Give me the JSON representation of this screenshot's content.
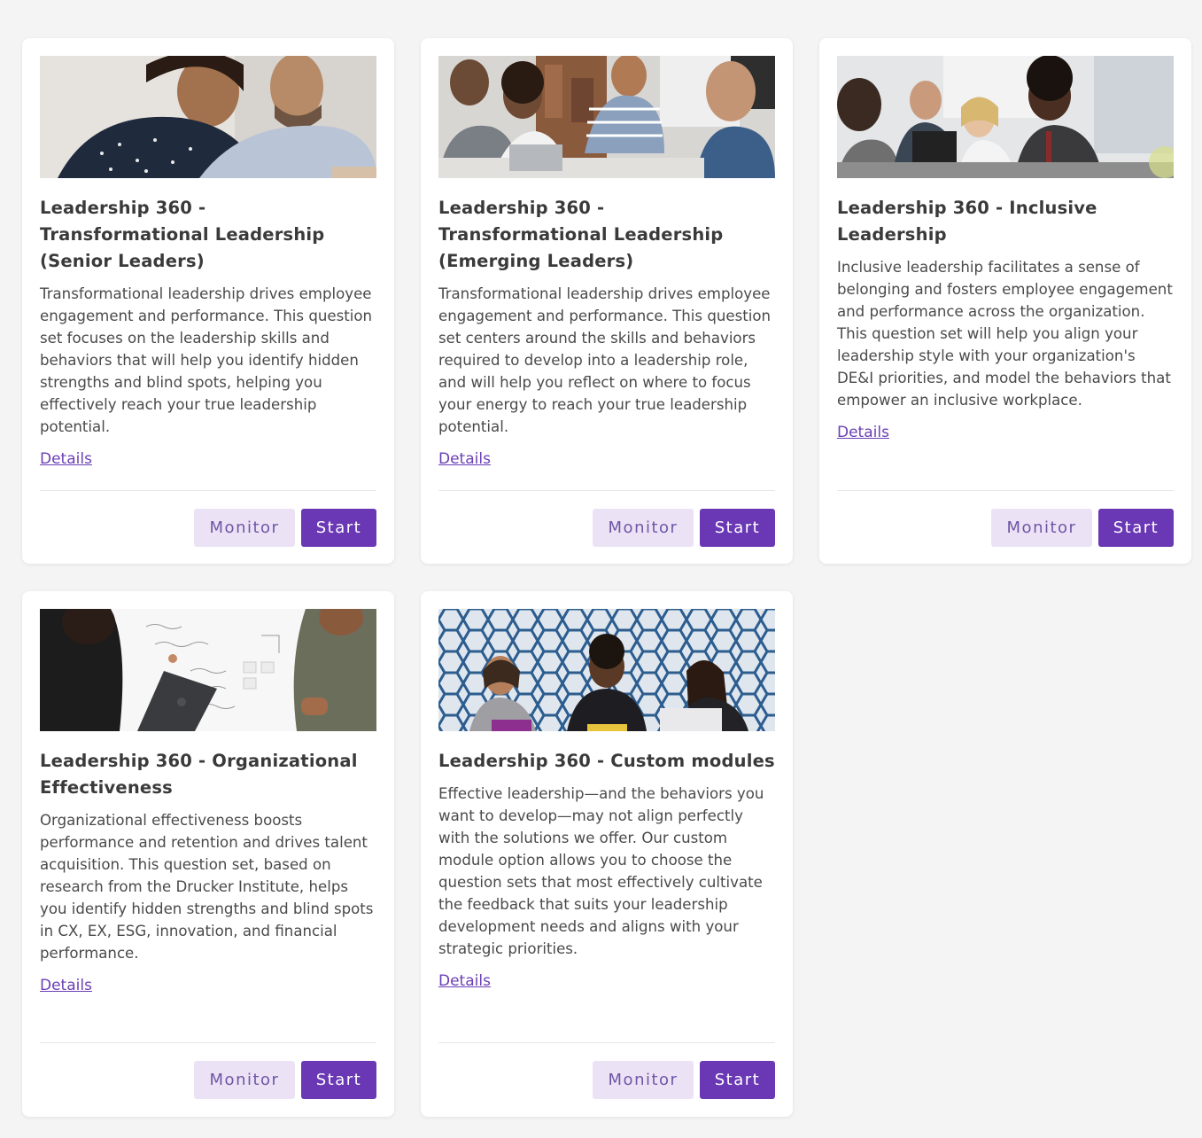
{
  "cards": [
    {
      "title": "Leadership 360 - Transformational Leadership (Senior Leaders)",
      "description": "Transformational leadership drives employee engagement and performance. This question set focuses on the leadership skills and behaviors that will help you identify hidden strengths and blind spots, helping you effectively reach your true leadership potential.",
      "details": "Details",
      "monitor": "Monitor",
      "start": "Start"
    },
    {
      "title": "Leadership 360 - Transformational Leadership (Emerging Leaders)",
      "description": "Transformational leadership drives employee engagement and performance. This question set centers around the skills and behaviors required to develop into a leadership role, and will help you reflect on where to focus your energy to reach your true leadership potential.",
      "details": "Details",
      "monitor": "Monitor",
      "start": "Start"
    },
    {
      "title": "Leadership 360 - Inclusive Leadership",
      "description": "Inclusive leadership facilitates a sense of belonging and fosters employee engagement and performance across the organization. This question set will help you align your leadership style with your organization's DE&I priorities, and model the behaviors that empower an inclusive workplace.",
      "details": "Details",
      "monitor": "Monitor",
      "start": "Start"
    },
    {
      "title": "Leadership 360 - Organizational Effectiveness",
      "description": "Organizational effectiveness boosts performance and retention and drives talent acquisition. This question set, based on research from the Drucker Institute, helps you identify hidden strengths and blind spots in CX, EX, ESG, innovation, and financial performance.",
      "details": "Details",
      "monitor": "Monitor",
      "start": "Start"
    },
    {
      "title": "Leadership 360 - Custom modules",
      "description": "Effective leadership—and the behaviors you want to develop—may not align perfectly with the solutions we offer. Our custom module option allows you to choose the question sets that most effectively cultivate the feedback that suits your leadership development needs and aligns with your strategic priorities.",
      "details": "Details",
      "monitor": "Monitor",
      "start": "Start"
    }
  ],
  "colors": {
    "accent": "#6a38b4",
    "monitor_bg": "#ebe3f5",
    "link": "#6b3fb5",
    "background": "#f4f4f4"
  }
}
